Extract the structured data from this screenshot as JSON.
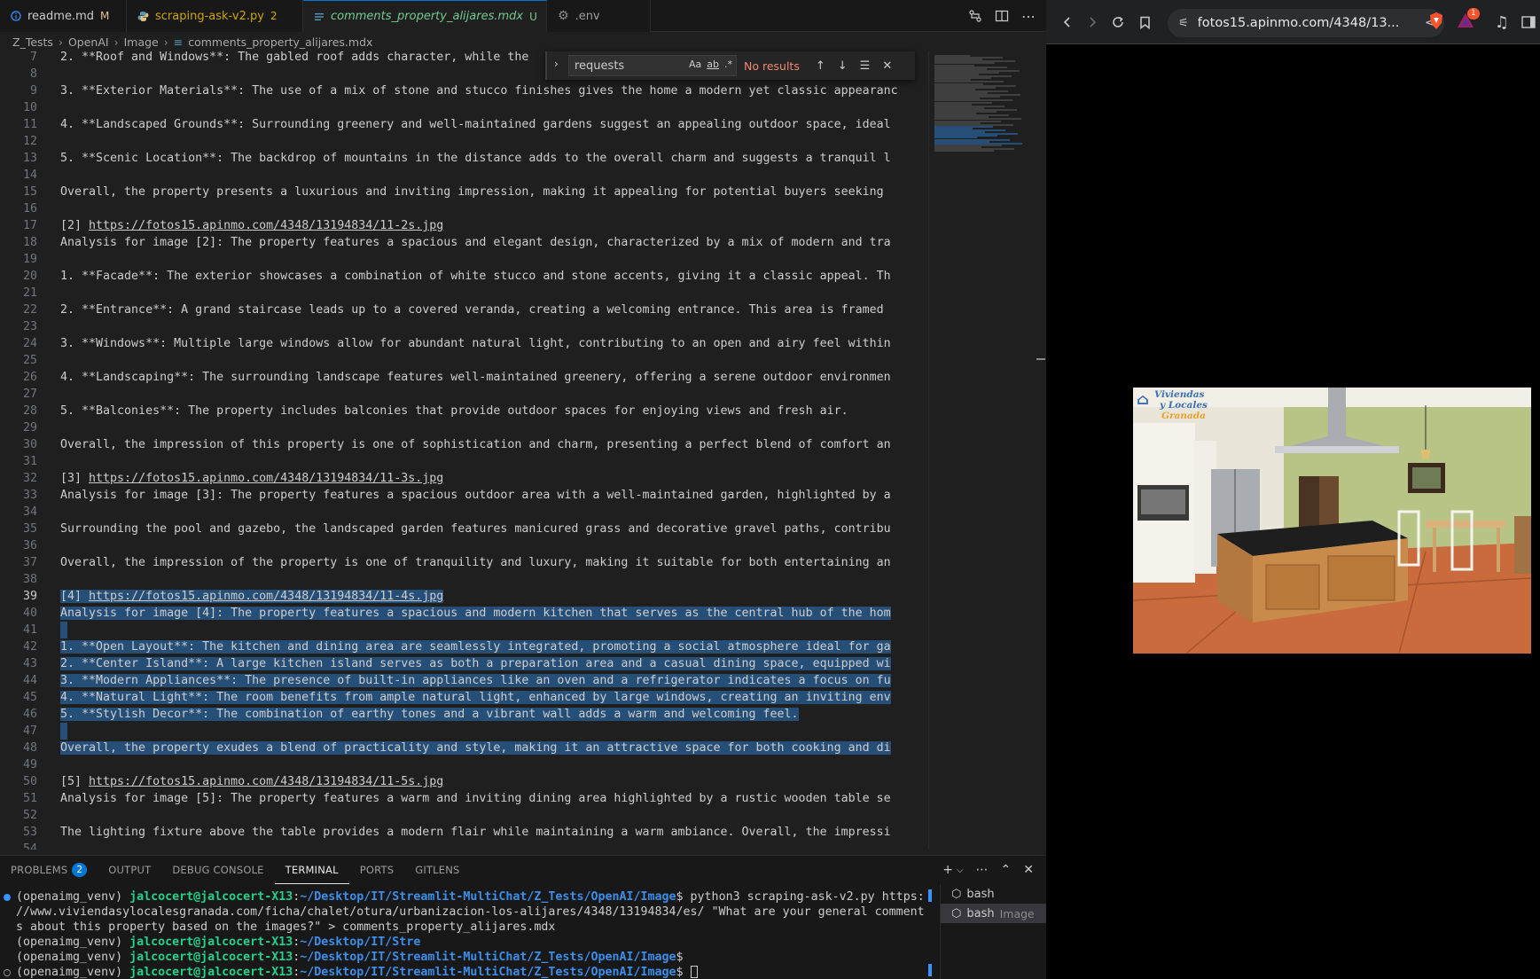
{
  "tabs": [
    {
      "label": "readme.md",
      "badge": "M",
      "badge_color": "#e2c08d",
      "label_color": "#cccccc",
      "icon": "info-icon"
    },
    {
      "label": "scraping-ask-v2.py",
      "badge": "2",
      "badge_color": "#cca700",
      "label_color": "#cca700",
      "icon": "python-icon"
    },
    {
      "label": "comments_property_alijares.mdx",
      "badge": "U",
      "badge_color": "#73c991",
      "label_color": "#73c991",
      "icon": "mdx-icon"
    },
    {
      "label": ".env",
      "badge": "",
      "badge_color": "",
      "label_color": "#9d9d9d",
      "icon": "gear-icon"
    }
  ],
  "breadcrumb": [
    "Z_Tests",
    "OpenAI",
    "Image",
    "comments_property_alijares.mdx"
  ],
  "find": {
    "query": "requests",
    "result": "No results",
    "opt_case": "Aa",
    "opt_word": "ab",
    "opt_regex": ".*"
  },
  "code_lines": [
    {
      "n": "7",
      "text": "2. **Roof and Windows**: The gabled roof adds character, while the",
      "sel": false
    },
    {
      "n": "8",
      "text": "",
      "sel": false
    },
    {
      "n": "9",
      "text": "3. **Exterior Materials**: The use of a mix of stone and stucco finishes gives the home a modern yet classic appearanc",
      "sel": false
    },
    {
      "n": "10",
      "text": "",
      "sel": false
    },
    {
      "n": "11",
      "text": "4. **Landscaped Grounds**: Surrounding greenery and well-maintained gardens suggest an appealing outdoor space, ideal",
      "sel": false
    },
    {
      "n": "12",
      "text": "",
      "sel": false
    },
    {
      "n": "13",
      "text": "5. **Scenic Location**: The backdrop of mountains in the distance adds to the overall charm and suggests a tranquil l",
      "sel": false
    },
    {
      "n": "14",
      "text": "",
      "sel": false
    },
    {
      "n": "15",
      "text": "Overall, the property presents a luxurious and inviting impression, making it appealing for potential buyers seeking",
      "sel": false
    },
    {
      "n": "16",
      "text": "",
      "sel": false
    },
    {
      "n": "17",
      "text": "[2] ",
      "url": "https://fotos15.apinmo.com/4348/13194834/11-2s.jpg",
      "sel": false
    },
    {
      "n": "18",
      "text": "Analysis for image [2]: The property features a spacious and elegant design, characterized by a mix of modern and tra",
      "sel": false
    },
    {
      "n": "19",
      "text": "",
      "sel": false
    },
    {
      "n": "20",
      "text": "1. **Facade**: The exterior showcases a combination of white stucco and stone accents, giving it a classic appeal. Th",
      "sel": false
    },
    {
      "n": "21",
      "text": "",
      "sel": false
    },
    {
      "n": "22",
      "text": "2. **Entrance**: A grand staircase leads up to a covered veranda, creating a welcoming entrance. This area is framed",
      "sel": false
    },
    {
      "n": "23",
      "text": "",
      "sel": false
    },
    {
      "n": "24",
      "text": "3. **Windows**: Multiple large windows allow for abundant natural light, contributing to an open and airy feel within",
      "sel": false
    },
    {
      "n": "25",
      "text": "",
      "sel": false
    },
    {
      "n": "26",
      "text": "4. **Landscaping**: The surrounding landscape features well-maintained greenery, offering a serene outdoor environmen",
      "sel": false
    },
    {
      "n": "27",
      "text": "",
      "sel": false
    },
    {
      "n": "28",
      "text": "5. **Balconies**: The property includes balconies that provide outdoor spaces for enjoying views and fresh air.",
      "sel": false
    },
    {
      "n": "29",
      "text": "",
      "sel": false
    },
    {
      "n": "30",
      "text": "Overall, the impression of this property is one of sophistication and charm, presenting a perfect blend of comfort an",
      "sel": false
    },
    {
      "n": "31",
      "text": "",
      "sel": false
    },
    {
      "n": "32",
      "text": "[3] ",
      "url": "https://fotos15.apinmo.com/4348/13194834/11-3s.jpg",
      "sel": false
    },
    {
      "n": "33",
      "text": "Analysis for image [3]: The property features a spacious outdoor area with a well-maintained garden, highlighted by a",
      "sel": false
    },
    {
      "n": "34",
      "text": "",
      "sel": false
    },
    {
      "n": "35",
      "text": "Surrounding the pool and gazebo, the landscaped garden features manicured grass and decorative gravel paths, contribu",
      "sel": false
    },
    {
      "n": "36",
      "text": "",
      "sel": false
    },
    {
      "n": "37",
      "text": "Overall, the impression of the property is one of tranquility and luxury, making it suitable for both entertaining an",
      "sel": false
    },
    {
      "n": "38",
      "text": "",
      "sel": false
    },
    {
      "n": "39",
      "text": "[4] ",
      "url": "https://fotos15.apinmo.com/4348/13194834/11-4s.jpg",
      "sel": true
    },
    {
      "n": "40",
      "text": "Analysis for image [4]: The property features a spacious and modern kitchen that serves as the central hub of the hom",
      "sel": true
    },
    {
      "n": "41",
      "text": "",
      "sel": true
    },
    {
      "n": "42",
      "text": "1. **Open Layout**: The kitchen and dining area are seamlessly integrated, promoting a social atmosphere ideal for ga",
      "sel": true
    },
    {
      "n": "43",
      "text": "2. **Center Island**: A large kitchen island serves as both a preparation area and a casual dining space, equipped wi",
      "sel": true
    },
    {
      "n": "44",
      "text": "3. **Modern Appliances**: The presence of built-in appliances like an oven and a refrigerator indicates a focus on fu",
      "sel": true
    },
    {
      "n": "45",
      "text": "4. **Natural Light**: The room benefits from ample natural light, enhanced by large windows, creating an inviting env",
      "sel": true
    },
    {
      "n": "46",
      "text": "5. **Stylish Decor**: The combination of earthy tones and a vibrant wall adds a warm and welcoming feel.",
      "sel": true
    },
    {
      "n": "47",
      "text": "",
      "sel": true
    },
    {
      "n": "48",
      "text": "Overall, the property exudes a blend of practicality and style, making it an attractive space for both cooking and di",
      "sel": true
    },
    {
      "n": "49",
      "text": "",
      "sel": false
    },
    {
      "n": "50",
      "text": "[5] ",
      "url": "https://fotos15.apinmo.com/4348/13194834/11-5s.jpg",
      "sel": false
    },
    {
      "n": "51",
      "text": "Analysis for image [5]: The property features a warm and inviting dining area highlighted by a rustic wooden table se",
      "sel": false
    },
    {
      "n": "52",
      "text": "",
      "sel": false
    },
    {
      "n": "53",
      "text": "The lighting fixture above the table provides a modern flair while maintaining a warm ambiance. Overall, the impressi",
      "sel": false
    },
    {
      "n": "54",
      "text": "",
      "sel": false
    }
  ],
  "panel": {
    "tabs": [
      "PROBLEMS",
      "OUTPUT",
      "DEBUG CONSOLE",
      "TERMINAL",
      "PORTS",
      "GITLENS"
    ],
    "problems_count": "2",
    "active_tab": "TERMINAL"
  },
  "terminal": {
    "lines": [
      {
        "env": "(openaimg_venv) ",
        "user": "jalcocert@jalcocert-X13",
        "sep": ":",
        "path": "~/Desktop/IT/Streamlit-MultiChat/Z_Tests/OpenAI/Image",
        "cmd": "$ python3 scraping-ask-v2.py https:",
        "dot": "blue"
      },
      {
        "env": "",
        "user": "",
        "sep": "",
        "path": "",
        "cmd": "//www.viviendasylocalesgranada.com/ficha/chalet/otura/urbanizacion-los-alijares/4348/13194834/es/ \"What are your general comment",
        "dot": ""
      },
      {
        "env": "",
        "user": "",
        "sep": "",
        "path": "",
        "cmd": "s about this property based on the images?\" > comments_property_alijares.mdx",
        "dot": ""
      },
      {
        "env": "(openaimg_venv) ",
        "user": "jalcocert@jalcocert-X13",
        "sep": ":",
        "path": "~/Desktop/IT/Stre",
        "cmd": "",
        "dot": ""
      },
      {
        "env": "(openaimg_venv) ",
        "user": "jalcocert@jalcocert-X13",
        "sep": ":",
        "path": "~/Desktop/IT/Streamlit-MultiChat/Z_Tests/OpenAI/Image",
        "cmd": "$",
        "dot": ""
      },
      {
        "env": "(openaimg_venv) ",
        "user": "jalcocert@jalcocert-X13",
        "sep": ":",
        "path": "~/Desktop/IT/Streamlit-MultiChat/Z_Tests/OpenAI/Image",
        "cmd": "$ ",
        "dot": "ring"
      }
    ],
    "list": [
      {
        "name": "bash",
        "sub": ""
      },
      {
        "name": "bash",
        "sub": "Image"
      }
    ]
  },
  "browser": {
    "url": "fotos15.apinmo.com/4348/13...",
    "brave_count": "1",
    "logo_lines": [
      "Viviendas",
      "y Locales",
      "Granada"
    ]
  },
  "colors": {
    "accent": "#0078d4",
    "selection": "#264f78",
    "user_green": "#23d18b",
    "path_blue": "#3b8eea"
  }
}
